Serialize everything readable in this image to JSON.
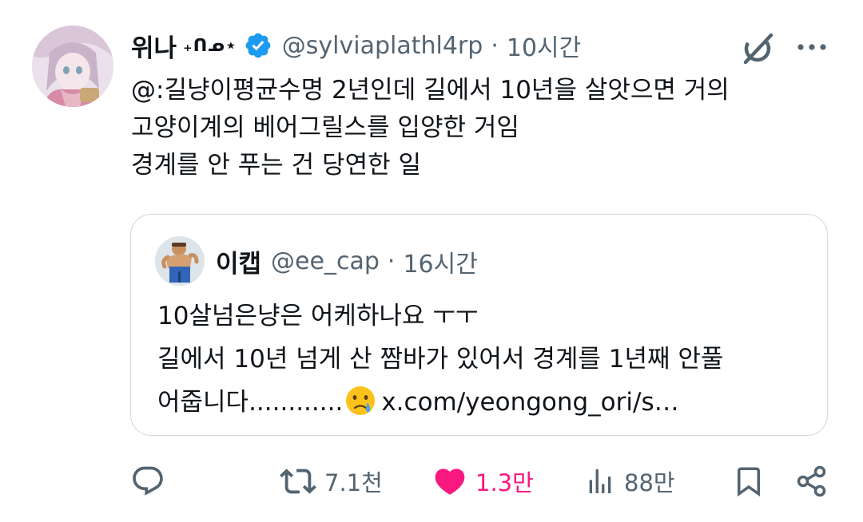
{
  "tweet": {
    "display_name": "위나",
    "name_decoration": "₊ᑎᓄ⋆",
    "handle": "@sylviaplathl4rp",
    "separator": "·",
    "time": "10시간",
    "text_lines": [
      "@:길냥이평균수명 2년인데 길에서 10년을 살앗으면 거의",
      "고양이계의 베어그릴스를 입양한 거임",
      "경계를 안 푸는 건 당연한 일"
    ]
  },
  "quote": {
    "display_name": "이캡",
    "handle": "@ee_cap",
    "separator": "·",
    "time": "16시간",
    "line1": "10살넘은냥은 어케하나요 ㅜㅜ",
    "line2": "길에서 10년 넘게 산 짬바가 있어서 경계를 1년째 안풀",
    "line3_before_emoji": "어줍니다............",
    "emoji": "crying-face-emoji",
    "link": "x.com/yeongong_ori/s…"
  },
  "actions": {
    "reply_count": "",
    "retweet_count": "7.1천",
    "like_count": "1.3만",
    "view_count": "88만"
  },
  "colors": {
    "text": "#0f1419",
    "secondary": "#536471",
    "verified": "#1d9bf0",
    "like": "#f91880",
    "border": "#cfd9de"
  },
  "icons": {
    "verified": "verified-badge-icon",
    "grok": "grok-icon",
    "more": "more-dots-icon",
    "reply": "reply-icon",
    "retweet": "retweet-icon",
    "like": "heart-icon",
    "views": "views-icon",
    "bookmark": "bookmark-icon",
    "share": "share-icon"
  }
}
